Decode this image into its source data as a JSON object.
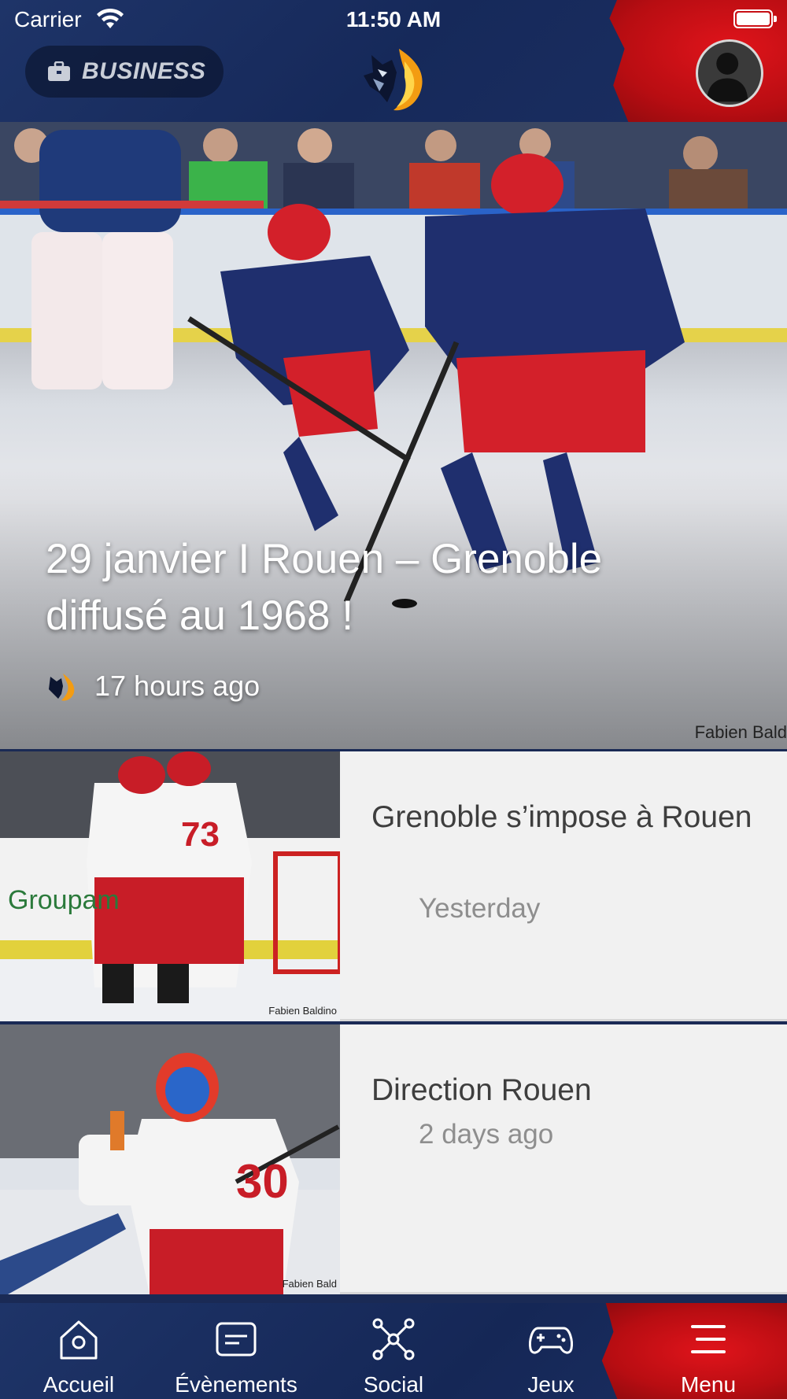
{
  "status_bar": {
    "carrier": "Carrier",
    "time": "11:50 AM"
  },
  "header": {
    "business_label": "BUSINESS",
    "logo_icon": "wolf-flame-logo-icon",
    "avatar_icon": "user-avatar-icon"
  },
  "hero": {
    "title": "29 janvier I Rouen – Grenoble diffusé au 1968 !",
    "time_ago": "17 hours ago",
    "credit": "Fabien Bald"
  },
  "articles": [
    {
      "title": "Grenoble s’impose à Rouen",
      "date": "Yesterday",
      "credit": "Fabien Baldino"
    },
    {
      "title": "Direction Rouen",
      "date": "2 days ago",
      "credit": "Fabien Bald"
    }
  ],
  "tabs": [
    {
      "label": "Accueil",
      "icon": "home-icon"
    },
    {
      "label": "Évènements",
      "icon": "events-icon"
    },
    {
      "label": "Social",
      "icon": "social-icon"
    },
    {
      "label": "Jeux",
      "icon": "gamepad-icon"
    },
    {
      "label": "Menu",
      "icon": "menu-icon"
    }
  ],
  "colors": {
    "navy": "#1b2f62",
    "red": "#d01016",
    "card_bg": "#f1f1f1"
  }
}
